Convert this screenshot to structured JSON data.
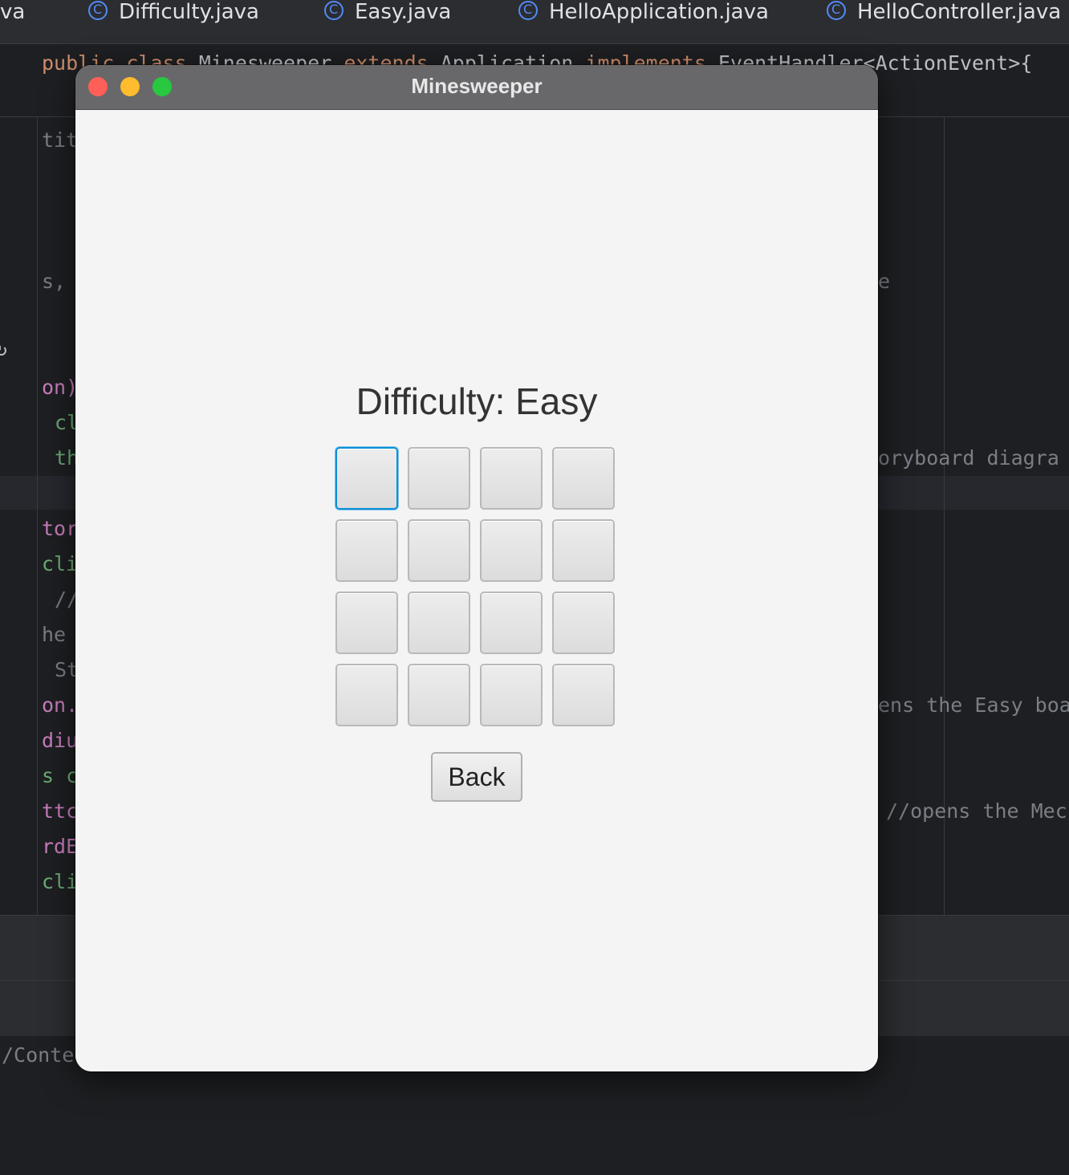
{
  "ide": {
    "tabs": [
      {
        "label": "va"
      },
      {
        "label": "Difficulty.java"
      },
      {
        "label": "Easy.java"
      },
      {
        "label": "HelloApplication.java"
      },
      {
        "label": "HelloController.java"
      }
    ],
    "class_decl": {
      "kw1": "public class",
      "name": "Minesweeper",
      "kw2": "extends",
      "parent": "Application",
      "kw3": "implements",
      "iface": "EventHandler<ActionEvent>{"
    },
    "left_fragments": [
      "tit",
      "s,",
      "on)",
      "cl",
      "th",
      "tor",
      "cli",
      "//",
      "he",
      "St",
      "on.",
      "diu",
      "s c",
      "ttc",
      "rdE",
      "cli",
      "/Conte"
    ],
    "right_fragments": [
      "e",
      "oryboard diagra",
      "ens the Easy boa",
      "//opens the Mec"
    ],
    "left_marker": "↻"
  },
  "window": {
    "title": "Minesweeper",
    "heading": "Difficulty: Easy",
    "back_label": "Back",
    "grid": {
      "rows": 4,
      "cols": 4,
      "focused_cell": [
        0,
        0
      ]
    }
  }
}
